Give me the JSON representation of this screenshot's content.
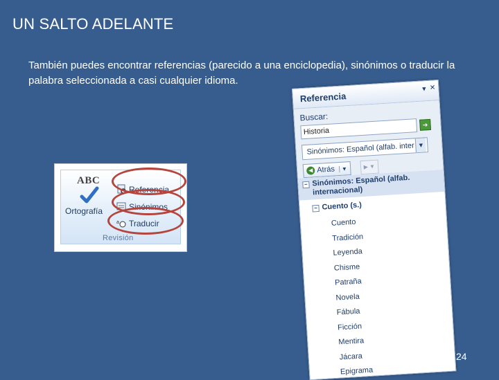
{
  "slide": {
    "title": "UN SALTO ADELANTE",
    "body": "También puedes encontrar referencias (parecido a una enciclopedia), sinónimos o traducir la palabra seleccionada a casi cualquier idioma.",
    "page_number": "24"
  },
  "ribbon": {
    "abc_icon_text": "ABC",
    "ortografia_label": "Ortografía",
    "commands": [
      {
        "label": "Referencia",
        "icon": "reference-book-icon"
      },
      {
        "label": "Sinónimos",
        "icon": "thesaurus-icon"
      },
      {
        "label": "Traducir",
        "icon": "translate-icon"
      }
    ],
    "group_label": "Revisión",
    "highlight_color": "#b5443c"
  },
  "research_pane": {
    "title": "Referencia",
    "search_label": "Buscar:",
    "search_value": "Historia",
    "go_icon": "go-arrow-icon",
    "source_select": "Sinónimos: Español (alfab. inter",
    "back_button": "Atrás",
    "result_header": "Sinónimos: Español (alfab. internacional)",
    "entry": "Cuento (s.)",
    "words": [
      "Cuento",
      "Tradición",
      "Leyenda",
      "Chisme",
      "Patraña",
      "Novela",
      "Fábula",
      "Ficción",
      "Mentira",
      "Jácara",
      "Epigrama"
    ]
  },
  "colors": {
    "background": "#375d8f",
    "text": "#ffffff",
    "pane_text": "#1f3d6b"
  }
}
